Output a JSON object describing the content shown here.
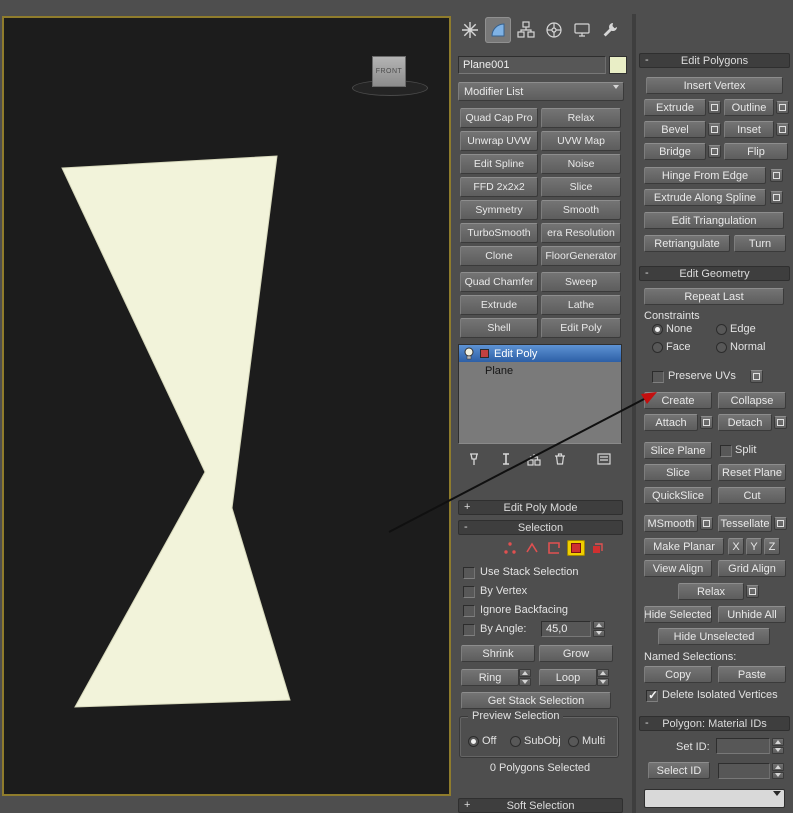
{
  "colors": {
    "accent_blue": "#3a6fb5",
    "subobj_red": "#d84040",
    "highlight_yellow": "#f0cf00",
    "arrow_red": "#c40f0f",
    "shape_cream": "#f2f3da",
    "object_swatch": "#e9eec6"
  },
  "icons": {
    "check": "✓",
    "minus": "-",
    "plus": "+",
    "tab_icons": [
      "create-icon",
      "modify-icon",
      "hierarchy-icon",
      "motion-icon",
      "display-icon",
      "utilities-icon"
    ],
    "stack_toolbar_icons": [
      "pin-stack-icon",
      "show-end-result-icon",
      "make-unique-icon",
      "remove-modifier-icon",
      "configure-modifier-sets-icon"
    ],
    "subobject_icons": [
      "vertex-icon",
      "edge-icon",
      "border-icon",
      "polygon-icon",
      "element-icon"
    ]
  },
  "viewport": {
    "gizmo_label": "FRONT"
  },
  "modify": {
    "object_name": "Plane001",
    "modifier_list": "Modifier List",
    "buttons": [
      "Quad Cap Pro",
      "Relax",
      "Unwrap UVW",
      "UVW Map",
      "Edit Spline",
      "Noise",
      "FFD 2x2x2",
      "Slice",
      "Symmetry",
      "Smooth",
      "TurboSmooth",
      "era Resolution",
      "Clone",
      "FloorGenerator",
      "Quad Chamfer",
      "Sweep",
      "Extrude",
      "Lathe",
      "Shell",
      "Edit Poly"
    ],
    "stack_items": [
      "Edit Poly",
      "Plane"
    ]
  },
  "mode": {
    "edit_poly_mode": "Edit Poly Mode"
  },
  "sel": {
    "title": "Selection",
    "use_stack": "Use Stack Selection",
    "by_vertex": "By Vertex",
    "ignore_backfacing": "Ignore Backfacing",
    "by_angle": "By Angle:",
    "by_angle_value": "45,0",
    "shrink": "Shrink",
    "grow": "Grow",
    "ring": "Ring",
    "loop": "Loop",
    "get_stack": "Get Stack Selection",
    "preview_title": "Preview Selection",
    "off": "Off",
    "subobj": "SubObj",
    "multi": "Multi",
    "status": "0 Polygons Selected",
    "soft_selection": "Soft Selection"
  },
  "ep": {
    "title": "Edit Polygons",
    "insert_vertex": "Insert Vertex",
    "extrude": "Extrude",
    "outline": "Outline",
    "bevel": "Bevel",
    "inset": "Inset",
    "bridge": "Bridge",
    "flip": "Flip",
    "hinge": "Hinge From Edge",
    "extrude_spline": "Extrude Along Spline",
    "edit_tri": "Edit Triangulation",
    "retriangulate": "Retriangulate",
    "turn": "Turn"
  },
  "eg": {
    "title": "Edit Geometry",
    "repeat_last": "Repeat Last",
    "constraints": "Constraints",
    "none": "None",
    "edge": "Edge",
    "face": "Face",
    "normal": "Normal",
    "preserve_uvs": "Preserve UVs",
    "create": "Create",
    "collapse": "Collapse",
    "attach": "Attach",
    "detach": "Detach",
    "slice_plane": "Slice Plane",
    "split": "Split",
    "slice": "Slice",
    "reset_plane": "Reset Plane",
    "quickslice": "QuickSlice",
    "cut": "Cut",
    "msmooth": "MSmooth",
    "tessellate": "Tessellate",
    "make_planar": "Make Planar",
    "x": "X",
    "y": "Y",
    "z": "Z",
    "view_align": "View Align",
    "grid_align": "Grid Align",
    "relax": "Relax",
    "hide_selected": "Hide Selected",
    "unhide_all": "Unhide All",
    "hide_unselected": "Hide Unselected",
    "named_selections": "Named Selections:",
    "copy": "Copy",
    "paste": "Paste",
    "delete_isolated": "Delete Isolated Vertices"
  },
  "mat": {
    "title": "Polygon: Material IDs",
    "set_id": "Set ID:",
    "select_id": "Select ID",
    "set_id_value": "",
    "select_id_value": ""
  }
}
